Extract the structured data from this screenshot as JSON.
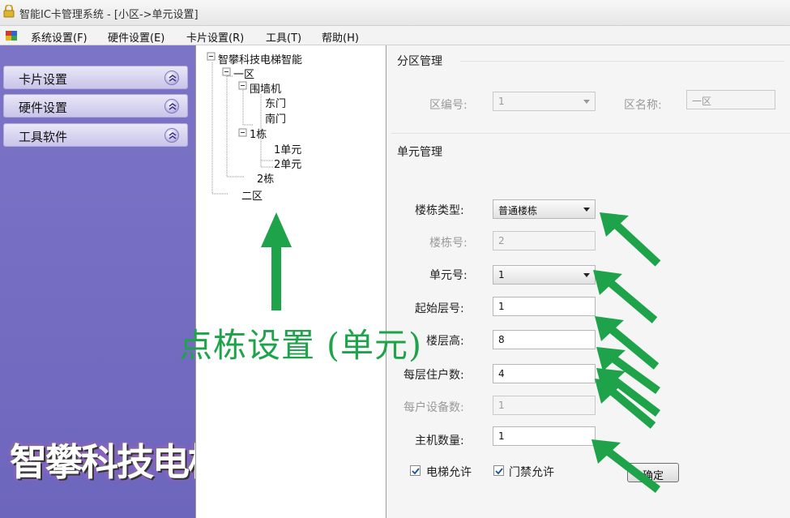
{
  "window": {
    "title": "智能IC卡管理系统 - [小区->单元设置]"
  },
  "menu": {
    "items": [
      "系统设置(F)",
      "硬件设置(E)",
      "卡片设置(R)",
      "工具(T)",
      "帮助(H)"
    ]
  },
  "sidebar": {
    "buttons": [
      "卡片设置",
      "硬件设置",
      "工具软件"
    ],
    "brand": "智攀科技电梯智能"
  },
  "tree": {
    "root": "智攀科技电梯智能",
    "zone1": "一区",
    "wall": "围墙机",
    "gate_east": "东门",
    "gate_south": "南门",
    "building1": "1栋",
    "unit1": "1单元",
    "unit2": "2单元",
    "building2": "2栋",
    "zone2": "二区"
  },
  "zone_section": {
    "title": "分区管理",
    "zone_no_label": "区编号:",
    "zone_no_value": "1",
    "zone_name_label": "区名称:",
    "zone_name_value": "一区"
  },
  "unit_section": {
    "title": "单元管理",
    "building_type_label": "楼栋类型:",
    "building_type_value": "普通楼栋",
    "building_no_label": "楼栋号:",
    "building_no_value": "2",
    "unit_no_label": "单元号:",
    "unit_no_value": "1",
    "start_floor_label": "起始层号:",
    "start_floor_value": "1",
    "floor_height_label": "楼层高:",
    "floor_height_value": "8",
    "households_label": "每层住户数:",
    "households_value": "4",
    "devices_label": "每户设备数:",
    "devices_value": "1",
    "hosts_label": "主机数量:",
    "hosts_value": "1",
    "elevator_allow_label": "电梯允许",
    "elevator_allow_checked": true,
    "door_allow_label": "门禁允许",
    "door_allow_checked": true,
    "confirm_label": "确定"
  },
  "annotation": {
    "text": "点栋设置 (单元)",
    "color": "#1ea34a"
  }
}
